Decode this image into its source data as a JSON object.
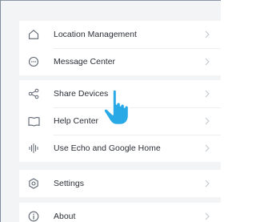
{
  "menu": {
    "group1": [
      {
        "label": "Location Management",
        "icon": "home-icon"
      },
      {
        "label": "Message Center",
        "icon": "chat-bubble-icon"
      }
    ],
    "group2": [
      {
        "label": "Share Devices",
        "icon": "share-icon"
      },
      {
        "label": "Help Center",
        "icon": "book-icon"
      },
      {
        "label": "Use Echo and Google Home",
        "icon": "voice-wave-icon"
      }
    ],
    "group3": [
      {
        "label": "Settings",
        "icon": "settings-hexagon-icon"
      }
    ],
    "group4": [
      {
        "label": "About",
        "icon": "info-icon"
      }
    ]
  },
  "colors": {
    "background": "#f3f4f6",
    "row_background": "#ffffff",
    "text": "#2b2f36",
    "icon": "#5c6570",
    "chevron": "#c3c8cf",
    "hand_pointer": "#29a9e6"
  },
  "overlay": {
    "icon": "tap-hand-pointer-icon"
  }
}
